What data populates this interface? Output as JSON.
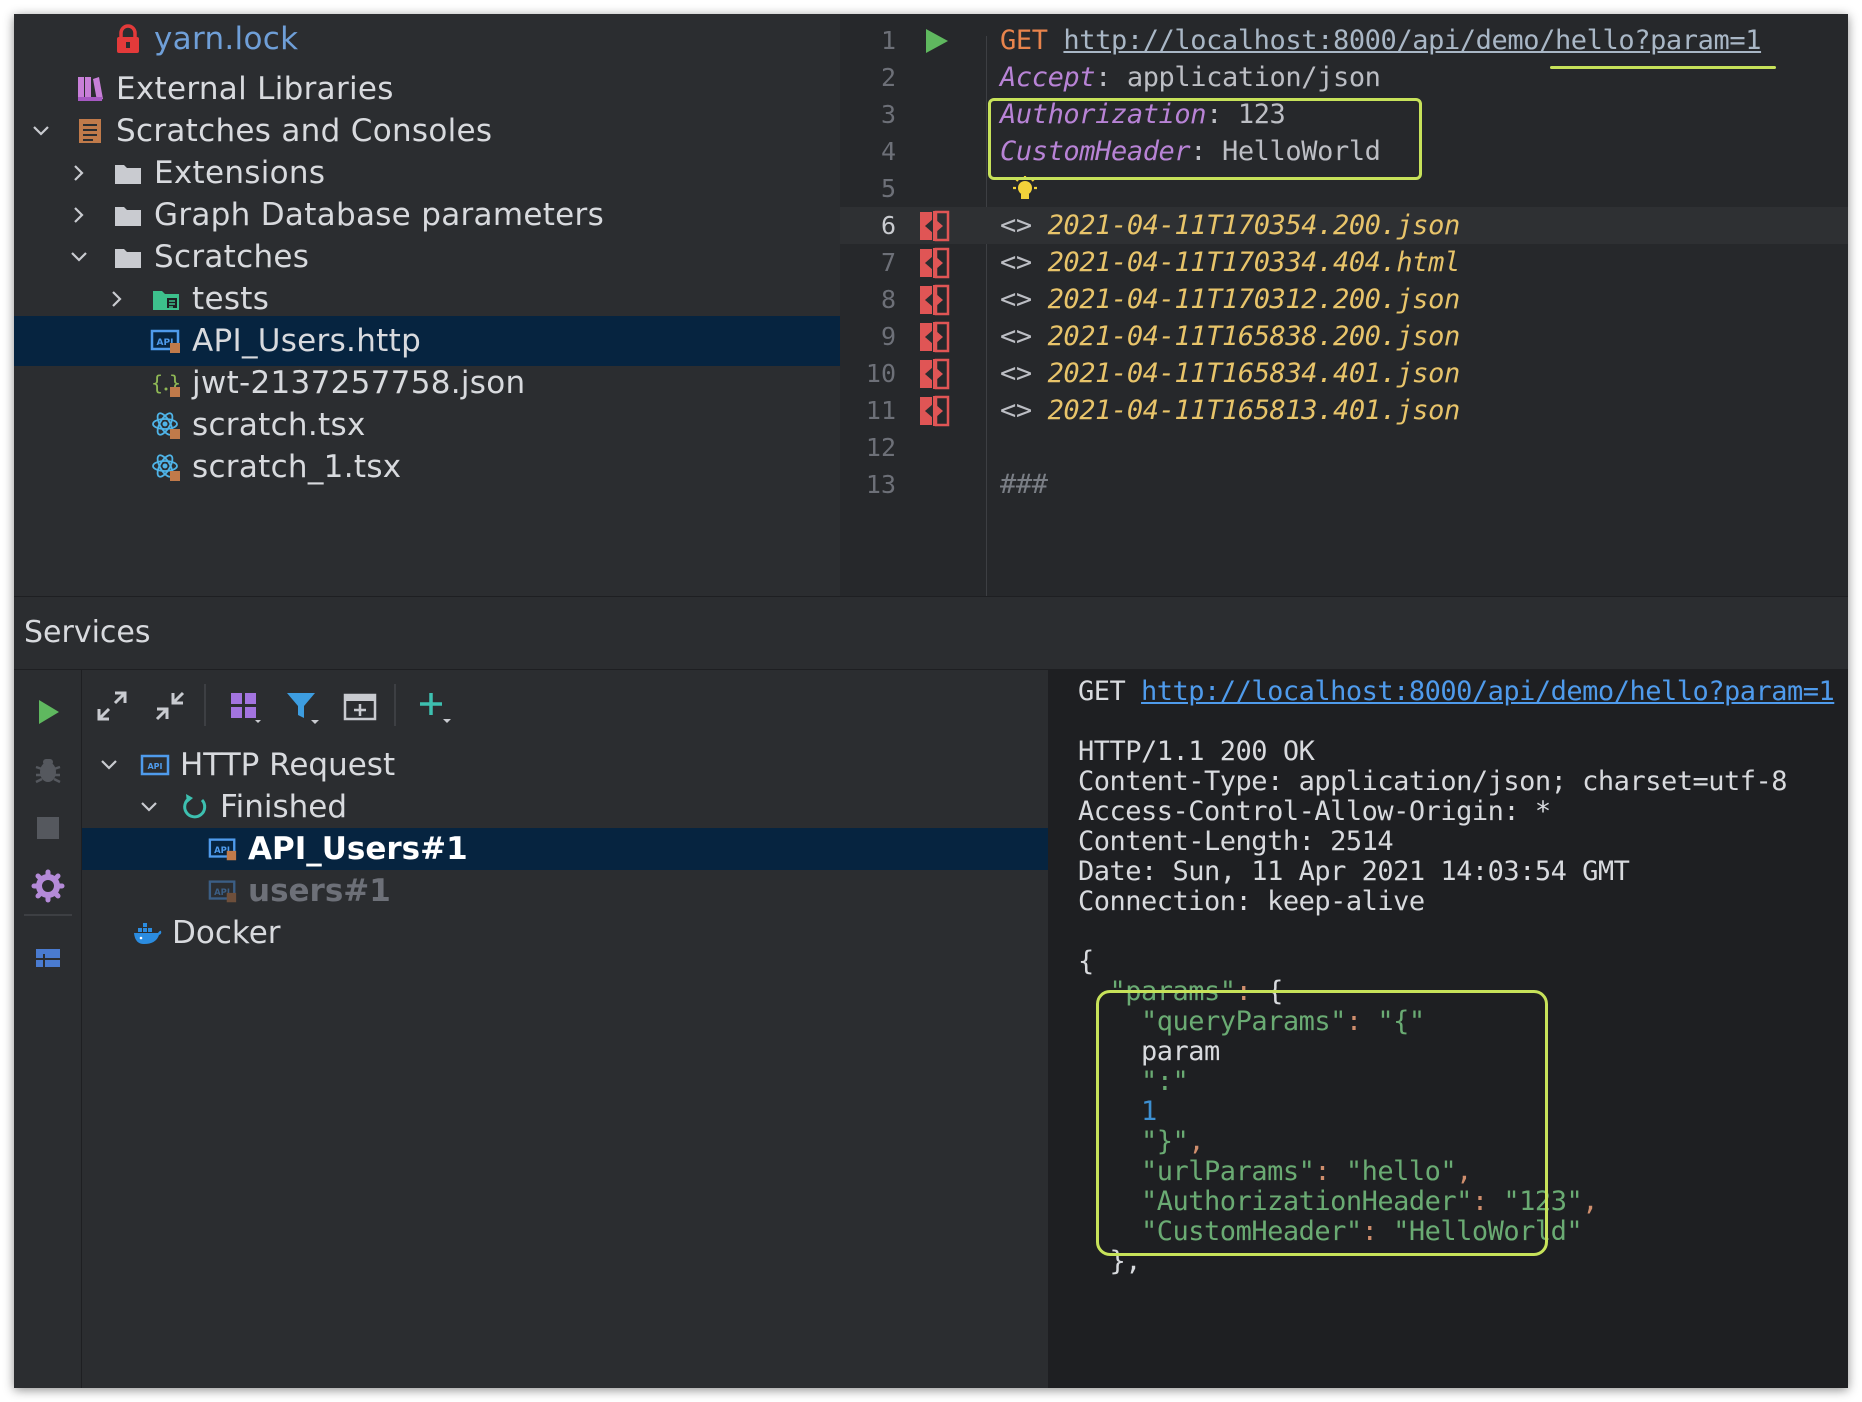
{
  "project_tree": {
    "items": [
      {
        "label": "yarn.lock",
        "icon": "lock-icon",
        "chevron": "",
        "depth": 2,
        "selected": false,
        "color": "blue"
      },
      {
        "label": "External Libraries",
        "icon": "library-icon",
        "chevron": "",
        "depth": 1,
        "selected": false
      },
      {
        "label": "Scratches and Consoles",
        "icon": "scratches-icon",
        "chevron": "down",
        "depth": 1,
        "selected": false
      },
      {
        "label": "Extensions",
        "icon": "folder-icon",
        "chevron": "right",
        "depth": 2,
        "selected": false
      },
      {
        "label": "Graph Database parameters",
        "icon": "folder-icon",
        "chevron": "right",
        "depth": 2,
        "selected": false
      },
      {
        "label": "Scratches",
        "icon": "folder-icon",
        "chevron": "down",
        "depth": 2,
        "selected": false
      },
      {
        "label": "tests",
        "icon": "test-folder-icon",
        "chevron": "right",
        "depth": 3,
        "selected": false
      },
      {
        "label": "API_Users.http",
        "icon": "http-file-icon",
        "chevron": "",
        "depth": 3,
        "selected": true
      },
      {
        "label": "jwt-2137257758.json",
        "icon": "json-file-icon",
        "chevron": "",
        "depth": 3,
        "selected": false
      },
      {
        "label": "scratch.tsx",
        "icon": "react-icon",
        "chevron": "",
        "depth": 3,
        "selected": false
      },
      {
        "label": "scratch_1.tsx",
        "icon": "react-icon",
        "chevron": "",
        "depth": 3,
        "selected": false
      }
    ]
  },
  "editor": {
    "lines": [
      {
        "num": "1",
        "gutter": "run-icon",
        "parts": [
          {
            "t": "GET ",
            "c": "kw-method"
          },
          {
            "t": "http://localhost:8000/api/demo/hello?param=1",
            "c": "url"
          }
        ]
      },
      {
        "num": "2",
        "gutter": "",
        "parts": [
          {
            "t": "Accept",
            "c": "hdr-key"
          },
          {
            "t": ": application/json",
            "c": "hdr-val"
          }
        ]
      },
      {
        "num": "3",
        "gutter": "",
        "parts": [
          {
            "t": "Authorization",
            "c": "hdr-key"
          },
          {
            "t": ": 123",
            "c": "hdr-val"
          }
        ]
      },
      {
        "num": "4",
        "gutter": "",
        "parts": [
          {
            "t": "CustomHeader",
            "c": "hdr-key"
          },
          {
            "t": ": HelloWorld",
            "c": "hdr-val"
          }
        ]
      },
      {
        "num": "5",
        "gutter": "",
        "parts": []
      },
      {
        "num": "6",
        "gutter": "diff-icon",
        "parts": [
          {
            "t": "<> ",
            "c": "arrows"
          },
          {
            "t": "2021-04-11T170354.200.json",
            "c": "resp-link"
          }
        ]
      },
      {
        "num": "7",
        "gutter": "diff-icon",
        "parts": [
          {
            "t": "<> ",
            "c": "arrows"
          },
          {
            "t": "2021-04-11T170334.404.html",
            "c": "resp-link"
          }
        ]
      },
      {
        "num": "8",
        "gutter": "diff-icon",
        "parts": [
          {
            "t": "<> ",
            "c": "arrows"
          },
          {
            "t": "2021-04-11T170312.200.json",
            "c": "resp-link"
          }
        ]
      },
      {
        "num": "9",
        "gutter": "diff-icon",
        "parts": [
          {
            "t": "<> ",
            "c": "arrows"
          },
          {
            "t": "2021-04-11T165838.200.json",
            "c": "resp-link"
          }
        ]
      },
      {
        "num": "10",
        "gutter": "diff-icon",
        "parts": [
          {
            "t": "<> ",
            "c": "arrows"
          },
          {
            "t": "2021-04-11T165834.401.json",
            "c": "resp-link"
          }
        ]
      },
      {
        "num": "11",
        "gutter": "diff-icon",
        "parts": [
          {
            "t": "<> ",
            "c": "arrows"
          },
          {
            "t": "2021-04-11T165813.401.json",
            "c": "resp-link"
          }
        ]
      },
      {
        "num": "12",
        "gutter": "",
        "parts": []
      },
      {
        "num": "13",
        "gutter": "",
        "parts": [
          {
            "t": "###",
            "c": "comment"
          }
        ]
      }
    ],
    "current_line": "6"
  },
  "services": {
    "title": "Services",
    "tree": [
      {
        "label": "HTTP Request",
        "icon": "http-request-icon",
        "chevron": "down",
        "depth": 1,
        "style": "normal",
        "selected": false
      },
      {
        "label": "Finished",
        "icon": "finished-icon",
        "chevron": "down",
        "depth": 2,
        "style": "normal",
        "selected": false
      },
      {
        "label": "API_Users#1",
        "icon": "http-file-icon",
        "chevron": "",
        "depth": 3,
        "style": "bold",
        "selected": true
      },
      {
        "label": "users#1",
        "icon": "http-file-icon",
        "chevron": "",
        "depth": 3,
        "style": "dim",
        "selected": false
      },
      {
        "label": "Docker",
        "icon": "docker-icon",
        "chevron": "",
        "depth": 2,
        "style": "normal",
        "selected": false
      }
    ]
  },
  "response": {
    "lines": [
      {
        "parts": [
          {
            "t": "GET ",
            "c": "js-plain"
          },
          {
            "t": "http://localhost:8000/api/demo/hello?param=1",
            "c": "rs-link"
          }
        ]
      },
      {
        "parts": []
      },
      {
        "parts": [
          {
            "t": "HTTP/1.1 200 OK",
            "c": "js-plain"
          }
        ]
      },
      {
        "parts": [
          {
            "t": "Content-Type: application/json; charset=utf-8",
            "c": "js-plain"
          }
        ]
      },
      {
        "parts": [
          {
            "t": "Access-Control-Allow-Origin: *",
            "c": "js-plain"
          }
        ]
      },
      {
        "parts": [
          {
            "t": "Content-Length: 2514",
            "c": "js-plain"
          }
        ]
      },
      {
        "parts": [
          {
            "t": "Date: Sun, 11 Apr 2021 14:03:54 GMT",
            "c": "js-plain"
          }
        ]
      },
      {
        "parts": [
          {
            "t": "Connection: keep-alive",
            "c": "js-plain"
          }
        ]
      },
      {
        "parts": []
      },
      {
        "parts": [
          {
            "t": "{",
            "c": "js-plain"
          }
        ]
      },
      {
        "parts": [
          {
            "t": "  ",
            "c": "js-plain"
          },
          {
            "t": "\"params\"",
            "c": "js-key"
          },
          {
            "t": ": ",
            "c": "js-punc"
          },
          {
            "t": "{",
            "c": "js-plain"
          }
        ]
      },
      {
        "parts": [
          {
            "t": "    ",
            "c": "js-plain"
          },
          {
            "t": "\"queryParams\"",
            "c": "js-key"
          },
          {
            "t": ": ",
            "c": "js-punc"
          },
          {
            "t": "\"{\"",
            "c": "js-str"
          }
        ]
      },
      {
        "parts": [
          {
            "t": "    param",
            "c": "js-plain"
          }
        ]
      },
      {
        "parts": [
          {
            "t": "    ",
            "c": "js-plain"
          },
          {
            "t": "\":\"",
            "c": "js-str"
          }
        ]
      },
      {
        "parts": [
          {
            "t": "    ",
            "c": "js-plain"
          },
          {
            "t": "1",
            "c": "js-num"
          }
        ]
      },
      {
        "parts": [
          {
            "t": "    ",
            "c": "js-plain"
          },
          {
            "t": "\"}\"",
            "c": "js-str"
          },
          {
            "t": ",",
            "c": "js-punc"
          }
        ]
      },
      {
        "parts": [
          {
            "t": "    ",
            "c": "js-plain"
          },
          {
            "t": "\"urlParams\"",
            "c": "js-key"
          },
          {
            "t": ": ",
            "c": "js-punc"
          },
          {
            "t": "\"hello\"",
            "c": "js-str"
          },
          {
            "t": ",",
            "c": "js-punc"
          }
        ]
      },
      {
        "parts": [
          {
            "t": "    ",
            "c": "js-plain"
          },
          {
            "t": "\"AuthorizationHeader\"",
            "c": "js-key"
          },
          {
            "t": ": ",
            "c": "js-punc"
          },
          {
            "t": "\"123\"",
            "c": "js-str"
          },
          {
            "t": ",",
            "c": "js-punc"
          }
        ]
      },
      {
        "parts": [
          {
            "t": "    ",
            "c": "js-plain"
          },
          {
            "t": "\"CustomHeader\"",
            "c": "js-key"
          },
          {
            "t": ": ",
            "c": "js-punc"
          },
          {
            "t": "\"HelloWorld\"",
            "c": "js-str"
          }
        ]
      },
      {
        "parts": [
          {
            "t": "  ",
            "c": "js-plain"
          },
          {
            "t": "},",
            "c": "js-plain"
          }
        ]
      }
    ]
  },
  "colors": {
    "highlight": "#c7e25a",
    "selection": "#062440",
    "run_green": "#5fb85f",
    "diff_red": "#e05555"
  }
}
